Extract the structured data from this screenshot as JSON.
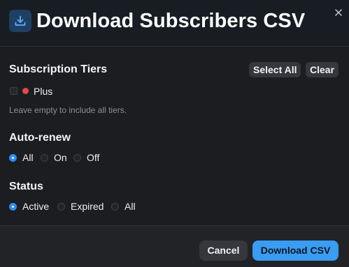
{
  "dialog": {
    "title": "Download Subscribers CSV",
    "accent_color": "#3a9cf2",
    "header_icon": "download-icon",
    "close_icon": "close-icon"
  },
  "tiers": {
    "title": "Subscription Tiers",
    "select_all_label": "Select All",
    "clear_label": "Clear",
    "items": [
      {
        "label": "Plus",
        "checked": false,
        "color": "#e5484d"
      }
    ],
    "hint": "Leave empty to include all tiers."
  },
  "auto_renew": {
    "title": "Auto-renew",
    "options": [
      {
        "label": "All",
        "selected": true
      },
      {
        "label": "On",
        "selected": false
      },
      {
        "label": "Off",
        "selected": false
      }
    ]
  },
  "status": {
    "title": "Status",
    "options": [
      {
        "label": "Active",
        "selected": true
      },
      {
        "label": "Expired",
        "selected": false
      },
      {
        "label": "All",
        "selected": false
      }
    ]
  },
  "footer": {
    "cancel_label": "Cancel",
    "download_label": "Download CSV"
  }
}
